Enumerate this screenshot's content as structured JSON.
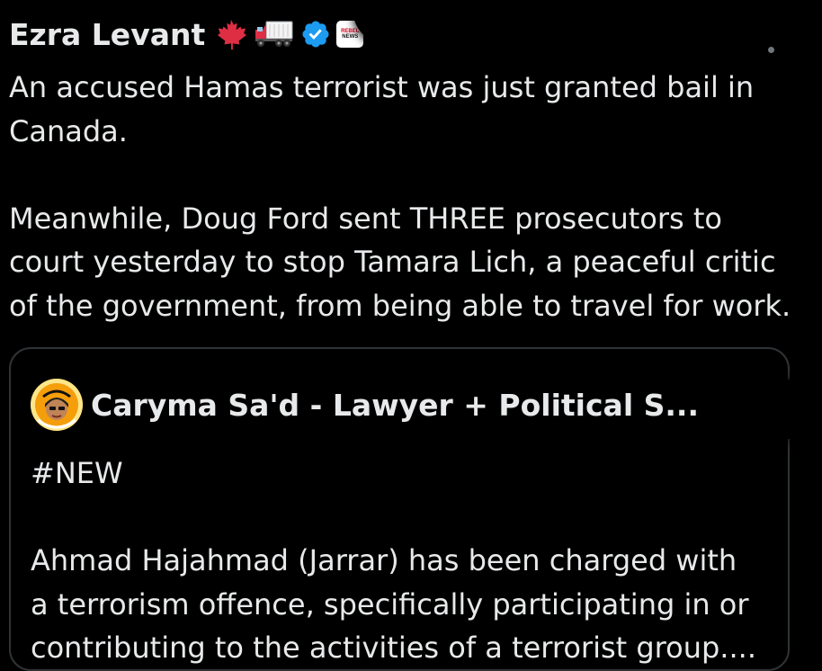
{
  "tweet": {
    "author_name": "Ezra Levant",
    "affiliate_badge": {
      "top": "REBEL",
      "bottom": "NEWS"
    },
    "icons": {
      "flag": "maple-leaf-icon",
      "truck": "truck-icon",
      "verified": "verified-badge-icon"
    },
    "paragraphs": [
      "An accused Hamas terrorist was just granted bail in\nCanada.",
      "Meanwhile, Doug Ford sent THREE prosecutors to\ncourt yesterday to stop Tamara Lich, a peaceful critic\nof the government, from being able to travel for work."
    ]
  },
  "quote": {
    "author_name": "Caryma Sa'd - Lawyer + Political S...",
    "avatar_icon": "avatar",
    "paragraphs": [
      "#NEW",
      "Ahmad Hajahmad (Jarrar) has been charged with\na terrorism offence, specifically participating in or\ncontributing to the activities of a terrorist group...."
    ]
  },
  "colors": {
    "background": "#000000",
    "text": "#e7e9ea",
    "border": "#2f3336",
    "verified": "#1d9bf0",
    "muted": "#71767b"
  }
}
